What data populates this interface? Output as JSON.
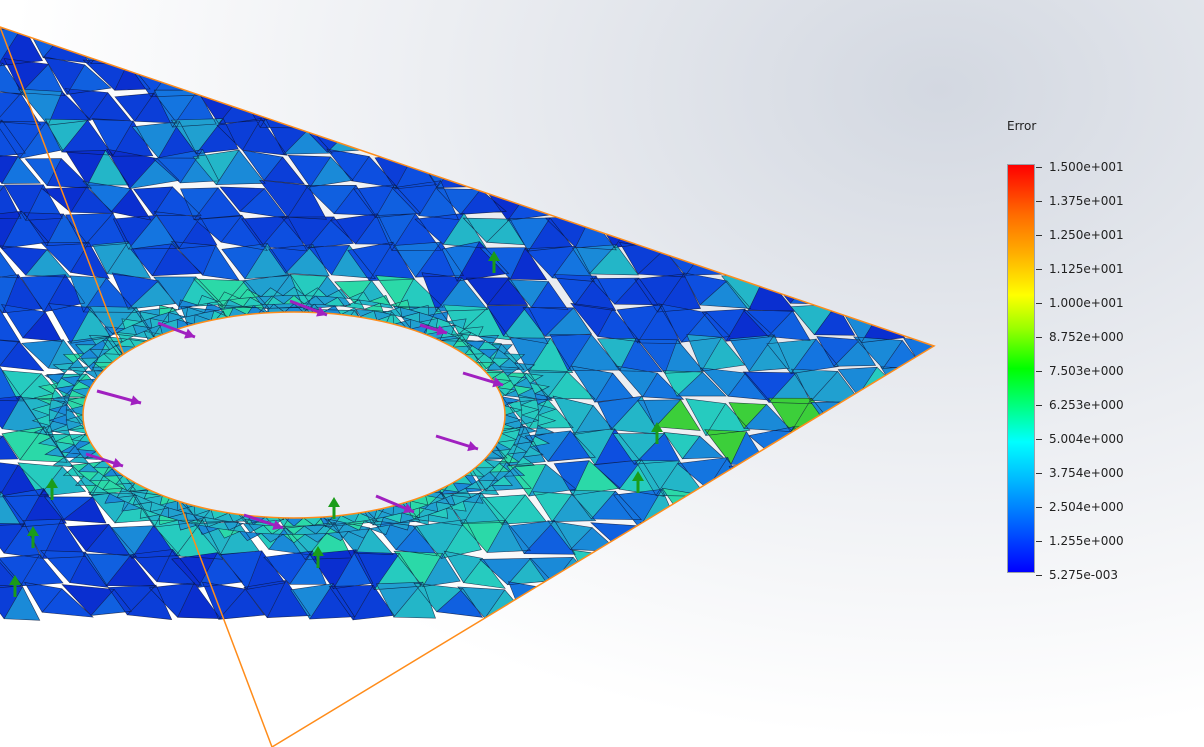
{
  "viewport": {
    "title_fragment": "",
    "legend": {
      "title": "Error",
      "labels": [
        "1.500e+001",
        "1.375e+001",
        "1.250e+001",
        "1.125e+001",
        "1.000e+001",
        "8.752e+000",
        "7.503e+000",
        "6.253e+000",
        "5.004e+000",
        "3.754e+000",
        "2.504e+000",
        "1.255e+000",
        "5.275e-003"
      ]
    }
  },
  "colors": {
    "plate_edge": "#ff8c1a",
    "load_arrow": "#a020c0",
    "fixture_arrow": "#1a9c1a"
  }
}
